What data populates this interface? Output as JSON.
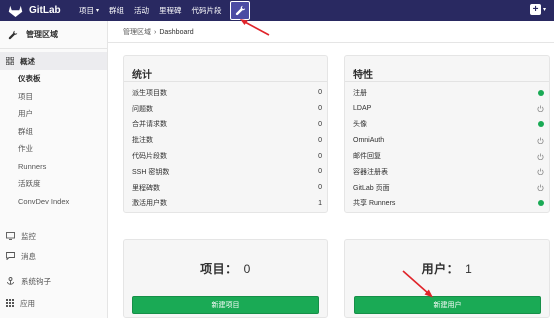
{
  "navbar": {
    "brand": "GitLab",
    "items": [
      {
        "label": "项目",
        "caret": true
      },
      {
        "label": "群组",
        "caret": false
      },
      {
        "label": "活动",
        "caret": false
      },
      {
        "label": "里程碑",
        "caret": false
      },
      {
        "label": "代码片段",
        "caret": false
      }
    ],
    "admin_icon": "wrench-icon",
    "new_icon": "plus-icon"
  },
  "sidebar": {
    "title": "管理区域",
    "overview": {
      "label": "概述",
      "items": [
        "仪表板",
        "项目",
        "用户",
        "群组",
        "作业",
        "Runners",
        "活跃度",
        "ConvDev Index"
      ]
    },
    "groups": [
      {
        "label": "监控",
        "icon": "monitor-icon"
      },
      {
        "label": "消息",
        "icon": "message-icon"
      },
      {
        "label": "系统钩子",
        "icon": "hook-icon"
      },
      {
        "label": "应用",
        "icon": "apps-icon"
      }
    ]
  },
  "breadcrumb": {
    "parent": "管理区域",
    "current": "Dashboard"
  },
  "stats": {
    "title": "统计",
    "rows": [
      {
        "label": "派生项目数",
        "value": "0"
      },
      {
        "label": "问题数",
        "value": "0"
      },
      {
        "label": "合并请求数",
        "value": "0"
      },
      {
        "label": "批注数",
        "value": "0"
      },
      {
        "label": "代码片段数",
        "value": "0"
      },
      {
        "label": "SSH 密钥数",
        "value": "0"
      },
      {
        "label": "里程碑数",
        "value": "0"
      },
      {
        "label": "激活用户数",
        "value": "1"
      }
    ]
  },
  "features": {
    "title": "特性",
    "rows": [
      {
        "label": "注册",
        "enabled": true
      },
      {
        "label": "LDAP",
        "enabled": false
      },
      {
        "label": "头像",
        "enabled": true
      },
      {
        "label": "OmniAuth",
        "enabled": false
      },
      {
        "label": "邮件回复",
        "enabled": false
      },
      {
        "label": "容器注册表",
        "enabled": false
      },
      {
        "label": "GitLab 页面",
        "enabled": false
      },
      {
        "label": "共享 Runners",
        "enabled": true
      }
    ]
  },
  "projects_card": {
    "label": "项目：",
    "count": "0",
    "button": "新建项目"
  },
  "users_card": {
    "label": "用户：",
    "count": "1",
    "button": "新建用户"
  },
  "colors": {
    "navbar": "#292961",
    "success": "#1aaa55",
    "annotation": "#e0242a"
  }
}
